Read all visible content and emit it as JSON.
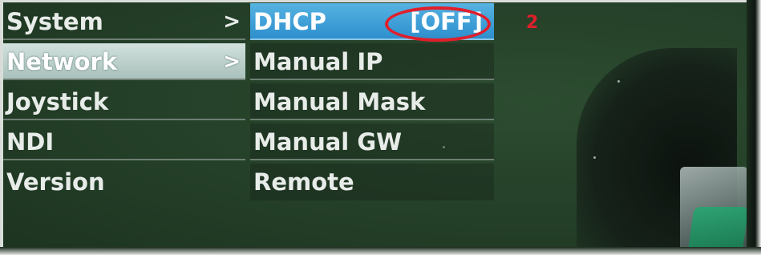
{
  "menu": {
    "left_items": [
      {
        "label": "System",
        "arrow": ">",
        "selected": false
      },
      {
        "label": "Network",
        "arrow": ">",
        "selected": true
      },
      {
        "label": "Joystick",
        "arrow": "",
        "selected": false
      },
      {
        "label": "NDI",
        "arrow": "",
        "selected": false
      },
      {
        "label": "Version",
        "arrow": "",
        "selected": false
      }
    ],
    "right_items": [
      {
        "label": "DHCP",
        "value": "[OFF]",
        "selected": true
      },
      {
        "label": "Manual IP",
        "value": "",
        "selected": false
      },
      {
        "label": "Manual Mask",
        "value": "",
        "selected": false
      },
      {
        "label": "Manual GW",
        "value": "",
        "selected": false
      },
      {
        "label": "Remote",
        "value": "",
        "selected": false
      }
    ]
  },
  "annotation": {
    "number": "2",
    "color": "#e01f2b"
  },
  "colors": {
    "screen_bg": "#243f28",
    "selected_left_bg": "#bcd2cd",
    "selected_right_bg": "#3fa0d8",
    "text": "#e8ece9"
  }
}
